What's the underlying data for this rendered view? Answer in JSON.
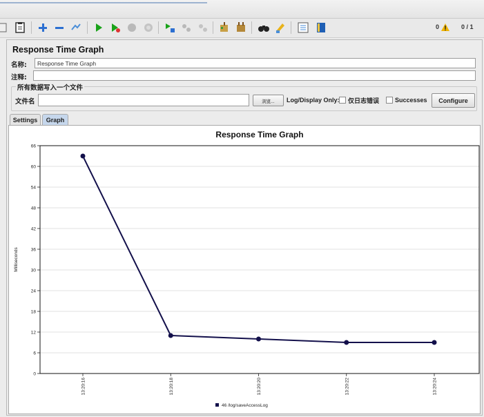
{
  "toolbar": {
    "icons": [
      "clipboard-icon",
      "add-icon",
      "remove-icon",
      "clear-icon",
      "start-icon",
      "start-no-pause-icon",
      "stop-icon",
      "shutdown-icon",
      "remote-start-icon",
      "remote-stop-icon",
      "remote-shutdown-icon",
      "broom-icon",
      "broom-all-icon",
      "binoculars-icon",
      "reset-search-icon",
      "function-helper-icon",
      "help-icon"
    ],
    "warning_count": "0",
    "thread_count": "0 / 1"
  },
  "panel": {
    "title": "Response Time Graph",
    "name_label": "名称:",
    "name_value": "Response Time Graph",
    "comment_label": "注释:",
    "comment_value": "",
    "group_title": "所有数据写入一个文件",
    "file_label": "文件名",
    "file_value": "",
    "browse_label": "浏览...",
    "log_display_label": "Log/Display Only:",
    "errors_only_label": "仅日志错误",
    "successes_label": "Successes",
    "configure_label": "Configure"
  },
  "tabs": [
    "Settings",
    "Graph"
  ],
  "chart_data": {
    "type": "line",
    "title": "Response Time Graph",
    "ylabel": "Milliseconds",
    "xlabel": "",
    "ylim": [
      0,
      66
    ],
    "yticks": [
      0,
      6,
      12,
      18,
      24,
      30,
      36,
      42,
      48,
      54,
      60,
      66
    ],
    "categories": [
      "13:20:16",
      "13:20:18",
      "13:20:20",
      "13:20:22",
      "13:20:24"
    ],
    "series": [
      {
        "name": "46 /log/saveAccessLog",
        "values": [
          63,
          11,
          10,
          9,
          9
        ],
        "color": "#13104b"
      }
    ],
    "legend": "bottom-center",
    "grid": true
  }
}
